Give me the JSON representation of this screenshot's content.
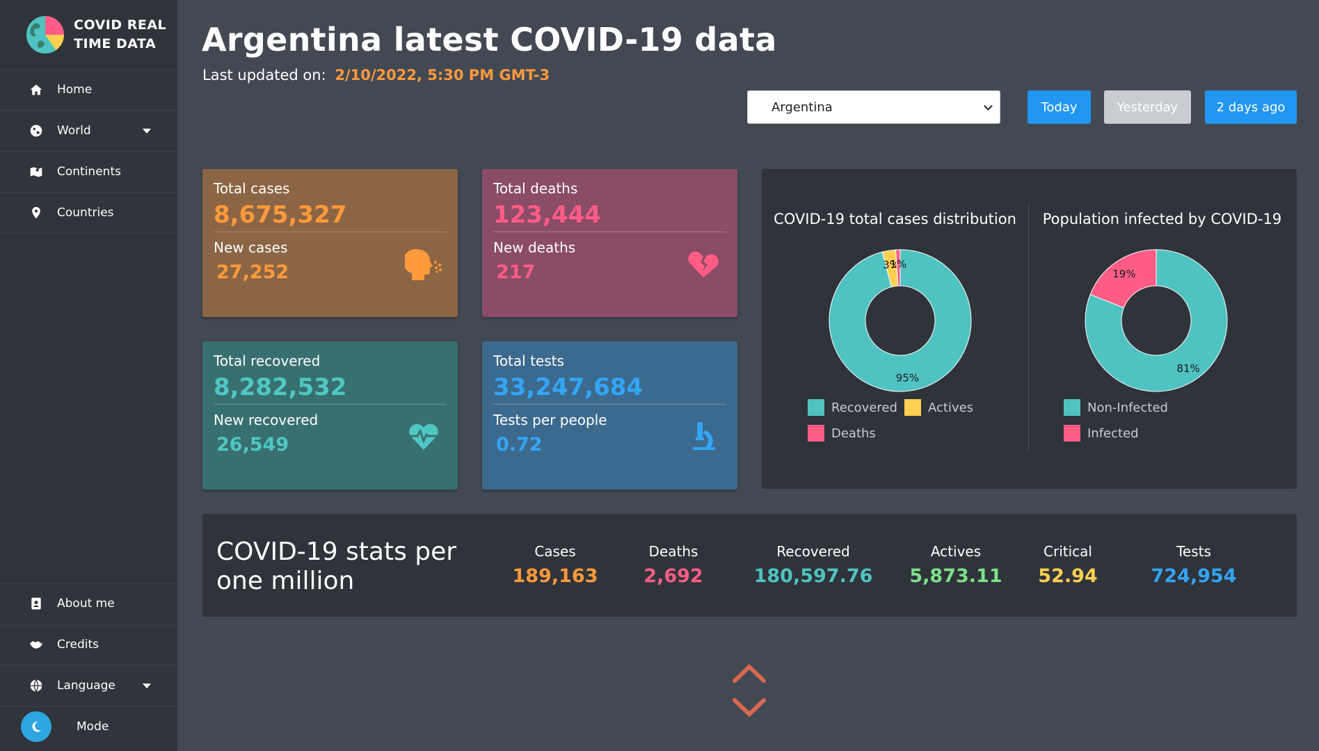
{
  "brand": {
    "line1": "COVID REAL",
    "line2": "TIME DATA"
  },
  "sidebar": {
    "items": [
      {
        "label": "Home",
        "icon": "home-icon"
      },
      {
        "label": "World",
        "icon": "globe-icon",
        "dropdown": true
      },
      {
        "label": "Continents",
        "icon": "map-icon"
      },
      {
        "label": "Countries",
        "icon": "location-pin-icon"
      }
    ],
    "bottom": [
      {
        "label": "About me",
        "icon": "contact-card-icon"
      },
      {
        "label": "Credits",
        "icon": "handshake-icon"
      },
      {
        "label": "Language",
        "icon": "globe-icon",
        "dropdown": true
      },
      {
        "label": "Mode",
        "icon": "moon-icon"
      }
    ]
  },
  "header": {
    "title": "Argentina latest COVID-19 data",
    "updated_label": "Last updated on:",
    "updated_value": "2/10/2022, 5:30 PM GMT-3"
  },
  "controls": {
    "country": "Argentina",
    "today": "Today",
    "yesterday": "Yesterday",
    "two_days": "2 days ago"
  },
  "cards": {
    "cases": {
      "label": "Total cases",
      "value": "8,675,327",
      "sub_label": "New cases",
      "sub_value": "27,252"
    },
    "deaths": {
      "label": "Total deaths",
      "value": "123,444",
      "sub_label": "New deaths",
      "sub_value": "217"
    },
    "recovered": {
      "label": "Total recovered",
      "value": "8,282,532",
      "sub_label": "New recovered",
      "sub_value": "26,549"
    },
    "tests": {
      "label": "Total tests",
      "value": "33,247,684",
      "sub_label": "Tests per people",
      "sub_value": "0.72"
    }
  },
  "colors": {
    "recovered": "#4fc3c1",
    "actives": "#ffd052",
    "deaths": "#ff5d86",
    "orange": "#ff9a3c",
    "blue": "#33a5f5",
    "green": "#7ee08a"
  },
  "chart_data": [
    {
      "type": "pie",
      "title": "COVID-19 total cases distribution",
      "categories": [
        "Recovered",
        "Actives",
        "Deaths"
      ],
      "values": [
        95,
        3,
        1
      ],
      "value_labels": [
        "95%",
        "3%",
        "1%"
      ],
      "colors": [
        "#4fc3c1",
        "#ffd052",
        "#ff5d86"
      ],
      "legend": "bottom"
    },
    {
      "type": "pie",
      "title": "Population infected by COVID-19",
      "categories": [
        "Non-Infected",
        "Infected"
      ],
      "values": [
        81,
        19
      ],
      "value_labels": [
        "81%",
        "19%"
      ],
      "colors": [
        "#4fc3c1",
        "#ff5d86"
      ],
      "legend": "bottom"
    }
  ],
  "per_million": {
    "title": "COVID-19 stats per one million",
    "stats": [
      {
        "label": "Cases",
        "value": "189,163",
        "color": "#ff9a3c"
      },
      {
        "label": "Deaths",
        "value": "2,692",
        "color": "#ff5d86"
      },
      {
        "label": "Recovered",
        "value": "180,597.76",
        "color": "#4fc3c1"
      },
      {
        "label": "Actives",
        "value": "5,873.11",
        "color": "#7ee08a"
      },
      {
        "label": "Critical",
        "value": "52.94",
        "color": "#ffd052"
      },
      {
        "label": "Tests",
        "value": "724,954",
        "color": "#33a5f5"
      }
    ]
  }
}
